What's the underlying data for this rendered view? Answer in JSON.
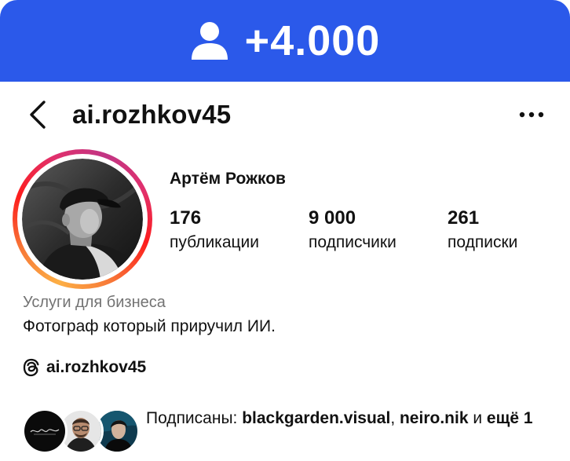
{
  "banner": {
    "count": "+4.000",
    "icon": "person-icon",
    "color": "#2b59ea"
  },
  "header": {
    "username": "ai.rozhkov45",
    "back_icon": "chevron-left-icon",
    "more_icon": "more-dots-icon"
  },
  "profile": {
    "display_name": "Артём Рожков",
    "stats": [
      {
        "value": "176",
        "label": "публикации"
      },
      {
        "value": "9 000",
        "label": "подписчики"
      },
      {
        "value": "261",
        "label": "подписки"
      }
    ],
    "category": "Услуги для бизнеса",
    "bio": "Фотограф который приручил ИИ.",
    "threads": {
      "icon": "threads-icon",
      "handle": "ai.rozhkov45"
    },
    "followed_by": {
      "prefix": "Подписаны: ",
      "user1": "blackgarden.visual",
      "separator": ", ",
      "user2": "neiro.nik",
      "conjunction": " и ",
      "more": "ещё 1"
    },
    "story_ring_colors": [
      "#fcaf45",
      "#f77737",
      "#fd1d1d",
      "#e1306c",
      "#c13584"
    ]
  }
}
